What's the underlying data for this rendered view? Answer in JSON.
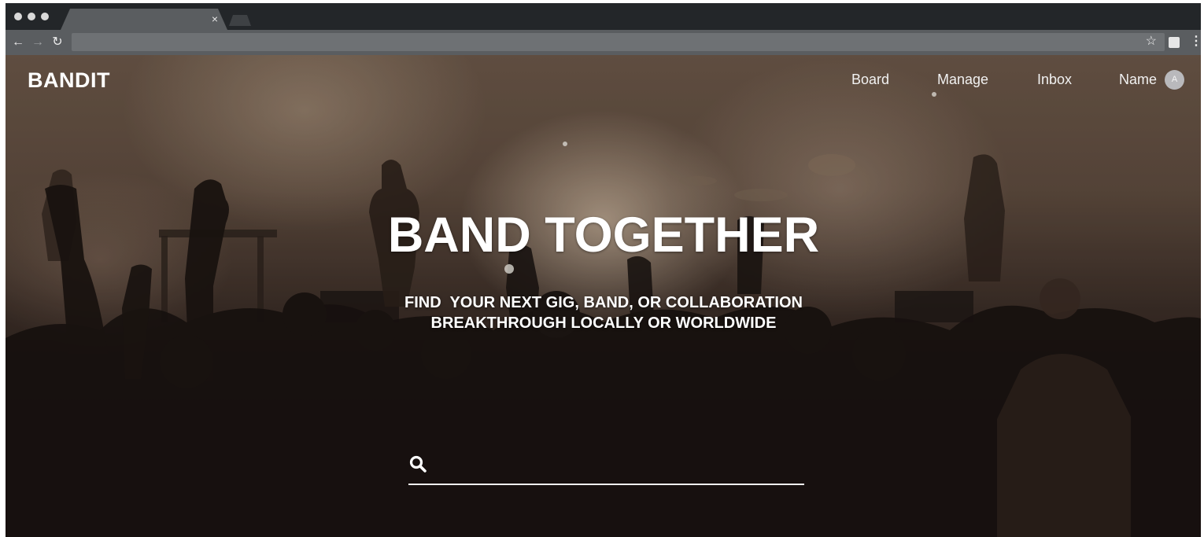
{
  "browser": {
    "tab_close": "×",
    "back_glyph": "←",
    "forward_glyph": "→",
    "reload_glyph": "↻",
    "bookmark_glyph": "☆",
    "menu_glyph": "⋮"
  },
  "header": {
    "brand": "BANDIT",
    "nav": [
      "Board",
      "Manage",
      "Inbox",
      "Name"
    ],
    "avatar_initial": "A"
  },
  "hero": {
    "headline": "BAND TOGETHER",
    "subline_1": "FIND  YOUR NEXT GIG, BAND, OR COLLABORATION",
    "subline_2": "BREAKTHROUGH LOCALLY OR WORLDWIDE"
  },
  "search": {
    "icon": "search-icon",
    "value": "",
    "placeholder": ""
  },
  "colors": {
    "text": "#ffffff",
    "chrome_dark": "#232629",
    "chrome_toolbar": "#5a5d60"
  }
}
